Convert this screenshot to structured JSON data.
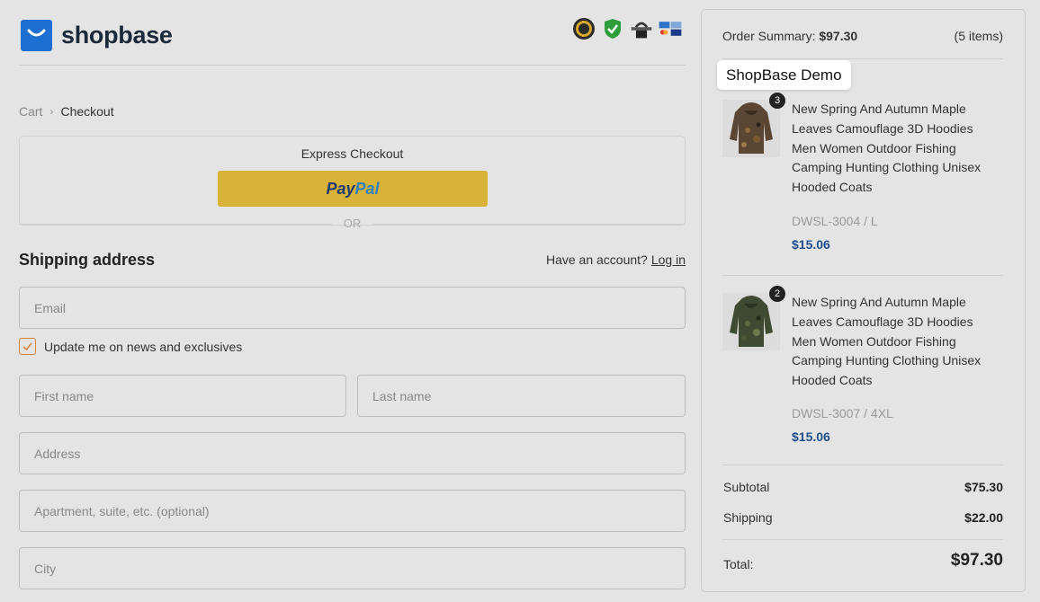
{
  "brand": {
    "name": "shopbase"
  },
  "trust_badges": [
    "guarantee-badge",
    "verified-shield-badge",
    "secure-lock-badge",
    "card-logos-badge"
  ],
  "breadcrumb": {
    "cart": "Cart",
    "checkout": "Checkout"
  },
  "express": {
    "title": "Express Checkout",
    "paypal_part1": "Pay",
    "paypal_part2": "Pal",
    "or": "OR"
  },
  "shipping": {
    "title": "Shipping address",
    "account_prompt": "Have an account?",
    "login": "Log in",
    "email_placeholder": "Email",
    "newsletter_label": "Update me on news and exclusives",
    "newsletter_checked": true,
    "first_name_placeholder": "First name",
    "last_name_placeholder": "Last name",
    "address_placeholder": "Address",
    "apartment_placeholder": "Apartment, suite, etc. (optional)",
    "city_placeholder": "City"
  },
  "summary": {
    "label": "Order Summary:",
    "amount": "$97.30",
    "items": "(5 items)",
    "tooltip": "ShopBase Demo",
    "products": [
      {
        "qty": "3",
        "name": "New Spring And Autumn Maple Leaves Camouflage 3D Hoodies Men Women Outdoor Fishing Camping Hunting Clothing Unisex Hooded Coats",
        "sku": "DWSL-3004 / L",
        "price": "$15.06"
      },
      {
        "qty": "2",
        "name": "New Spring And Autumn Maple Leaves Camouflage 3D Hoodies Men Women Outdoor Fishing Camping Hunting Clothing Unisex Hooded Coats",
        "sku": "DWSL-3007 / 4XL",
        "price": "$15.06"
      }
    ],
    "subtotal_label": "Subtotal",
    "subtotal": "$75.30",
    "shipping_label": "Shipping",
    "shipping": "$22.00",
    "total_label": "Total:",
    "total": "$97.30"
  },
  "colors": {
    "brand_blue": "#1d6fd1",
    "paypal_yellow": "#d9b337",
    "price_blue": "#1f4e8c",
    "checkbox_orange": "#d8823a"
  }
}
